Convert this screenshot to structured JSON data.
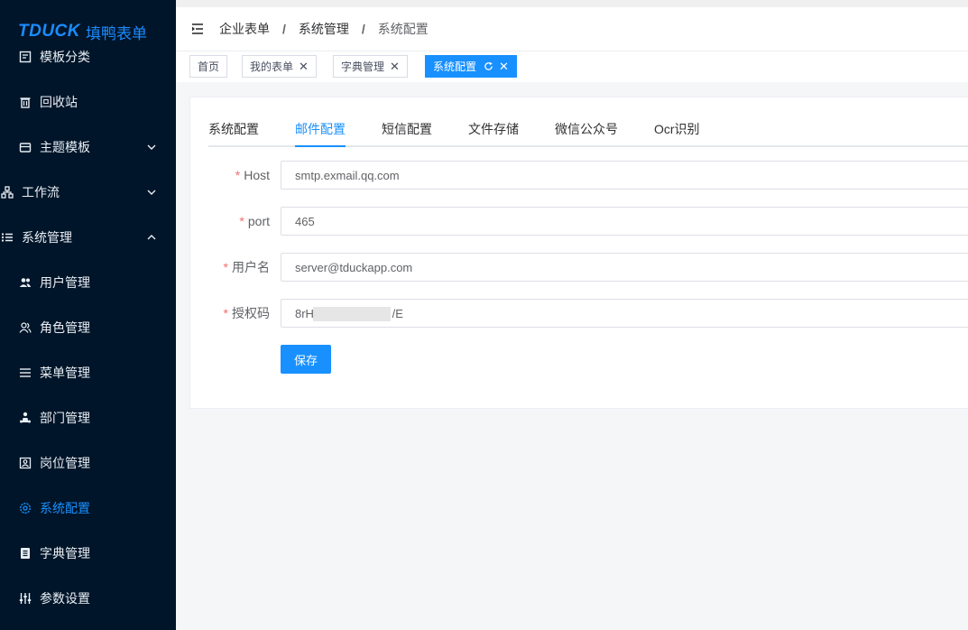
{
  "logo": {
    "mark": "TDUCK",
    "name": "填鸭表单"
  },
  "sidebar": {
    "items": [
      {
        "label": "模板分类",
        "icon": "template-category-icon"
      },
      {
        "label": "回收站",
        "icon": "trash-icon"
      },
      {
        "label": "主题模板",
        "icon": "theme-icon",
        "expandable": true,
        "expanded": false
      },
      {
        "label": "工作流",
        "icon": "workflow-icon",
        "expandable": true,
        "expanded": false
      },
      {
        "label": "系统管理",
        "icon": "list-icon",
        "expandable": true,
        "expanded": true
      },
      {
        "label": "用户管理",
        "icon": "users-icon"
      },
      {
        "label": "角色管理",
        "icon": "role-icon"
      },
      {
        "label": "菜单管理",
        "icon": "menu-icon"
      },
      {
        "label": "部门管理",
        "icon": "department-icon"
      },
      {
        "label": "岗位管理",
        "icon": "position-icon"
      },
      {
        "label": "系统配置",
        "icon": "gear-icon",
        "active": true
      },
      {
        "label": "字典管理",
        "icon": "dictionary-icon"
      },
      {
        "label": "参数设置",
        "icon": "sliders-icon"
      }
    ]
  },
  "breadcrumb": [
    "企业表单",
    "系统管理",
    "系统配置"
  ],
  "breadcrumb_sep": "/",
  "tags": [
    {
      "label": "首页",
      "closable": false
    },
    {
      "label": "我的表单",
      "closable": true
    },
    {
      "label": "字典管理",
      "closable": true
    },
    {
      "label": "系统配置",
      "closable": true,
      "active": true
    }
  ],
  "tabs": [
    {
      "label": "系统配置"
    },
    {
      "label": "邮件配置",
      "active": true
    },
    {
      "label": "短信配置"
    },
    {
      "label": "文件存储"
    },
    {
      "label": "微信公众号"
    },
    {
      "label": "Ocr识别"
    }
  ],
  "form": {
    "fields": [
      {
        "label": "Host",
        "required": true,
        "value": "smtp.exmail.qq.com"
      },
      {
        "label": "port",
        "required": true,
        "value": "465"
      },
      {
        "label": "用户名",
        "required": true,
        "value": "server@tduckapp.com"
      },
      {
        "label": "授权码",
        "required": true,
        "value": "8rH                        /E"
      }
    ],
    "required_mark": "*",
    "save_label": "保存"
  },
  "colors": {
    "accent": "#1890ff",
    "sidebar_bg": "#001529",
    "required": "#f56c6c"
  }
}
